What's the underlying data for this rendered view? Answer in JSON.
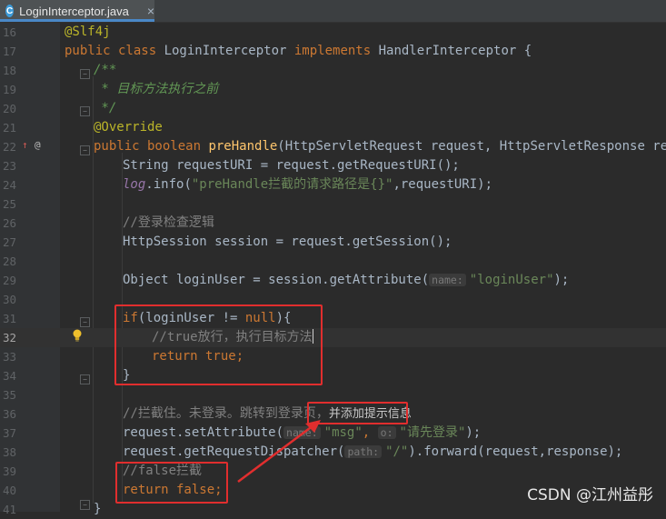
{
  "tab": {
    "title": "LoginInterceptor.java",
    "icon_letter": "C",
    "close": "×"
  },
  "gutter": {
    "impl_marker": "↑",
    "override_marker": "@"
  },
  "lines": [
    {
      "n": "16"
    },
    {
      "n": "17"
    },
    {
      "n": "18"
    },
    {
      "n": "19"
    },
    {
      "n": "20"
    },
    {
      "n": "21"
    },
    {
      "n": "22"
    },
    {
      "n": "23"
    },
    {
      "n": "24"
    },
    {
      "n": "25"
    },
    {
      "n": "26"
    },
    {
      "n": "27"
    },
    {
      "n": "28"
    },
    {
      "n": "29"
    },
    {
      "n": "30"
    },
    {
      "n": "31"
    },
    {
      "n": "32"
    },
    {
      "n": "33"
    },
    {
      "n": "34"
    },
    {
      "n": "35"
    },
    {
      "n": "36"
    },
    {
      "n": "37"
    },
    {
      "n": "38"
    },
    {
      "n": "39"
    },
    {
      "n": "40"
    },
    {
      "n": "41"
    }
  ],
  "code": {
    "l16": "@Slf4j",
    "l17_public": "public class ",
    "l17_name": "LoginInterceptor ",
    "l17_impl": "implements ",
    "l17_iface": "HandlerInterceptor {",
    "l18": "/**",
    "l19": " * 目标方法执行之前",
    "l20": " */",
    "l21": "@Override",
    "l22_kw": "public boolean ",
    "l22_fn": "preHandle",
    "l22_rest": "(HttpServletRequest request, HttpServletResponse respon",
    "l23": "String requestURI = request.getRequestURI();",
    "l24_log": "log",
    "l24_mid": ".info(",
    "l24_str": "\"preHandle拦截的请求路径是{}\"",
    "l24_end": ",requestURI);",
    "l26": "//登录检查逻辑",
    "l27": "HttpSession session = request.getSession();",
    "l29_a": "Object loginUser = session.getAttribute(",
    "l29_hint": "name:",
    "l29_str": "\"loginUser\"",
    "l29_end": ");",
    "l31_if": "if",
    "l31_a": "(loginUser != ",
    "l31_null": "null",
    "l31_b": "){",
    "l32": "//true放行，执行目标方法",
    "l33_kw": "return true",
    "l33_end": ";",
    "l34": "}",
    "l36": "//拦截住。未登录。跳转到登录页，",
    "l36_note": "并添加提示信息",
    "l37_a": "request.setAttribute(",
    "l37_hint1": "name:",
    "l37_str1": "\"msg\"",
    "l37_comma": ", ",
    "l37_hint2": "o:",
    "l37_str2": "\"请先登录\"",
    "l37_end": ");",
    "l38_a": "request.getRequestDispatcher(",
    "l38_hint": "path:",
    "l38_str": "\"/\"",
    "l38_end": ").forward(request,response);",
    "l39": "//false拦截",
    "l40_kw": "return false",
    "l40_end": ";",
    "l41": "}"
  },
  "watermark": "CSDN @江州益彤",
  "colors": {
    "highlight_box": "#e12e2e",
    "keyword": "#cc7832",
    "string": "#6a8759",
    "comment": "#808080",
    "method": "#ffc66d",
    "annotation": "#bbb529"
  }
}
